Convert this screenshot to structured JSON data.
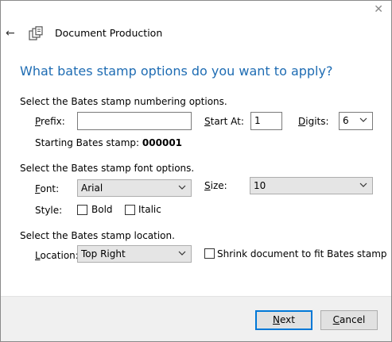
{
  "window": {
    "close_glyph": "✕"
  },
  "header": {
    "back_glyph": "←",
    "icon": "document-production-icon",
    "title": "Document Production"
  },
  "heading": "What bates stamp options do you want to apply?",
  "numbering": {
    "section_label": "Select the Bates stamp numbering options.",
    "prefix_label": "Prefix:",
    "prefix_value": "",
    "start_label": "Start At:",
    "start_value": "1",
    "digits_label": "Digits:",
    "digits_value": "6",
    "starting_label": "Starting Bates stamp:",
    "starting_value": "000001"
  },
  "font": {
    "section_label": "Select the Bates stamp font options.",
    "font_label": "Font:",
    "font_value": "Arial",
    "size_label": "Size:",
    "size_value": "10",
    "style_label": "Style:",
    "bold_label": "Bold",
    "bold_checked": false,
    "italic_label": "Italic",
    "italic_checked": false
  },
  "location": {
    "section_label": "Select the Bates stamp location.",
    "location_label": "Location:",
    "location_value": "Top Right",
    "shrink_label": "Shrink document to fit Bates stamp",
    "shrink_checked": false
  },
  "footer": {
    "next_label": "Next",
    "cancel_label": "Cancel"
  },
  "colors": {
    "heading": "#1e6cb3",
    "primary_border": "#0078d7",
    "footer_bg": "#f0f0f0"
  }
}
